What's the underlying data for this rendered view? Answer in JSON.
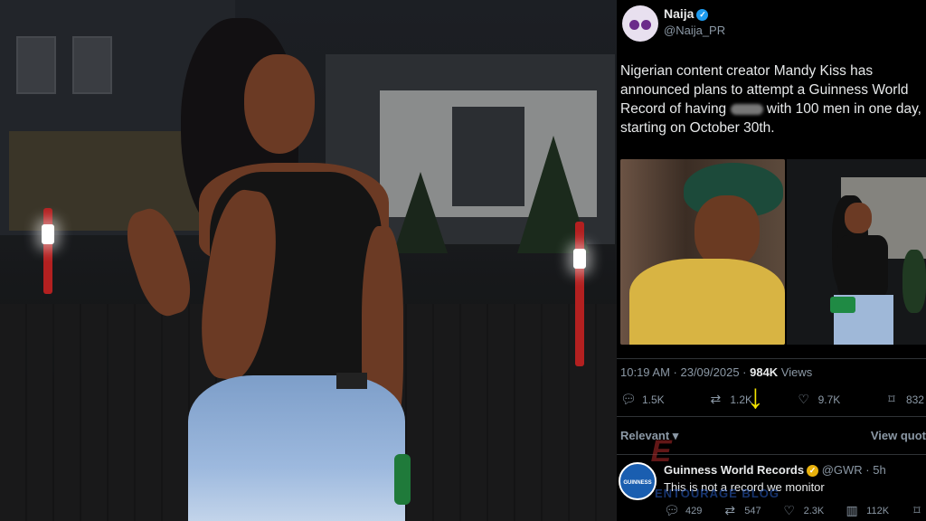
{
  "left_photo": {
    "label": "photo-of-woman-at-night"
  },
  "tweet": {
    "display_name": "Naija",
    "handle": "@Naija_PR",
    "body_before": "Nigerian content creator Mandy Kiss has announced plans to attempt a Guinness World Record of having ",
    "body_after": " with 100 men in one day, starting on October 30th.",
    "time": "10:19 AM · 23/09/2025 · ",
    "views_count": "984K",
    "views_label": " Views",
    "replies": "1.5K",
    "reposts": "1.2K",
    "likes": "9.7K",
    "bookmarks": "832",
    "relevant_label": "Relevant ▾",
    "view_quotes_label": "View quot"
  },
  "reply": {
    "display_name": "Guinness World Records",
    "handle": "@GWR · 5h",
    "text": "This is not a record we monitor",
    "replies": "429",
    "reposts": "547",
    "likes": "2.3K",
    "views": "112K",
    "avatar_text": "GUINNESS"
  },
  "watermark": {
    "text": "ENTOURAGE BLOG"
  },
  "colors": {
    "accent_blue": "#1d9bf0",
    "gold_badge": "#e8b10c",
    "arrow_yellow": "#f4e400"
  }
}
